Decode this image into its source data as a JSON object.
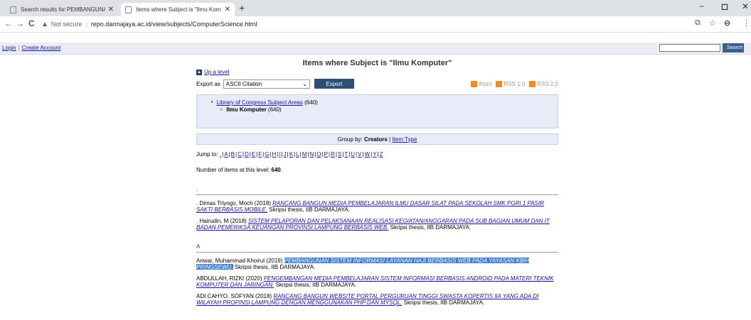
{
  "browser": {
    "tabs": [
      {
        "title": "Search results for PEMBANGUNA",
        "close": "✕"
      },
      {
        "title": "Items where Subject is \"Ilmu Kom",
        "close": "✕"
      }
    ],
    "new_tab": "+",
    "window_controls": [
      "−",
      "◻",
      "✕"
    ],
    "nav": {
      "back": "←",
      "forward": "→",
      "reload": "C"
    },
    "address": {
      "warning_icon": "▲",
      "not_secure": "Not secure",
      "separator": "|",
      "url": "repo.darmajaya.ac.id/view/subjects/ComputerScience.html"
    },
    "toolbar_icons": {
      "translate": "⧉",
      "star": "☆",
      "profile": "⊖",
      "menu": "⋮"
    }
  },
  "site_header": {
    "login": "Login",
    "pipe": "|",
    "create_account": "Create Account",
    "search_placeholder": "",
    "search_button": "Search"
  },
  "page": {
    "title": "Items where Subject is \"Ilmu Komputer\"",
    "up_level": "Up a level",
    "up_icon": "▲",
    "export_label": "Export as",
    "export_selected": "ASCII Citation",
    "export_caret": "⌄",
    "export_button": "Export",
    "feeds": [
      "Atom",
      "RSS 1.0",
      "RSS 2.0"
    ],
    "subject_tree": {
      "root": {
        "label": "Library of Congress Subject Areas",
        "count": "(640)"
      },
      "child": {
        "label": "Ilmu Komputer",
        "count": "(640)"
      }
    },
    "group_by": {
      "label": "Group by:",
      "current": "Creators",
      "pipe": "|",
      "other": "Item Type"
    },
    "jump_to": {
      "label": "Jump to:",
      "letters": [
        ".",
        "A",
        "B",
        "C",
        "D",
        "E",
        "F",
        "G",
        "H",
        "I",
        "J",
        "K",
        "L",
        "M",
        "N",
        "O",
        "P",
        "R",
        "S",
        "T",
        "U",
        "V",
        "W",
        "Y",
        "Z"
      ]
    },
    "count_label": "Number of items at this level:",
    "count_value": "640",
    "count_period": ".",
    "sections": [
      {
        "heading": ".",
        "entries": [
          {
            "author": ". Dimas Triyogo, Moch (2018)",
            "title": "RANCANG BANGUN MEDIA PEMBELAJARAN ILMU DASAR SILAT PADA SEKOLAH SMK PGRI 1 PASIR SAKTI BERBASIS MOBILE.",
            "rest": "Skripsi thesis, IIB DARMAJAYA."
          },
          {
            "author": ". Hairudin, M (2018)",
            "title": "SISTEM PELAPORAN DAN PELAKSANAAN REALISASI KEGIATAN/ANGGARAN PADA SUB BAGIAN UMUM DAN IT BADAN PEMERIKSA KEUANGAN PROVINSI LAMPUNG BERBASIS WEB.",
            "rest": "Skripsi thesis, IIB DARMAJAYA."
          }
        ]
      },
      {
        "heading": "A",
        "entries": [
          {
            "author": "Anwar, Muhammad Khoirul (2019)",
            "title": "PEMBANGUNAN SISTEM INFORMASI LAYANAN HAJI BERBASIS WEB PADA YAYASAN KBIH PRINGSEWU.",
            "rest": "Skripsi thesis, IIB DARMAJAYA.",
            "highlighted": true
          },
          {
            "author": "ABDULLAH, RIZKI (2020)",
            "title": "PENGEMBANGAN MEDIA PEMBELAJARAN SISTEM INFORMASI BERBASIS ANDROID PADA MATERI TEKNIK KOMPUTER DAN JARINGAN.",
            "rest": "Skripsi thesis, IIB DARMAJAYA."
          },
          {
            "author": "ADI CAHYO, SOFYAN (2018)",
            "title": "RANCANG BANGUN WEBSITE PORTAL PERGURUAN TINGGI SWASTA KOPERTIS IIA YANG ADA DI WILAYAH PROPINSI LAMPUNG DENGAN MENGGUNAKAN PHP DAN MYSQL.",
            "rest": "Skripsi thesis, IIB DARMAJAYA."
          }
        ]
      }
    ]
  }
}
